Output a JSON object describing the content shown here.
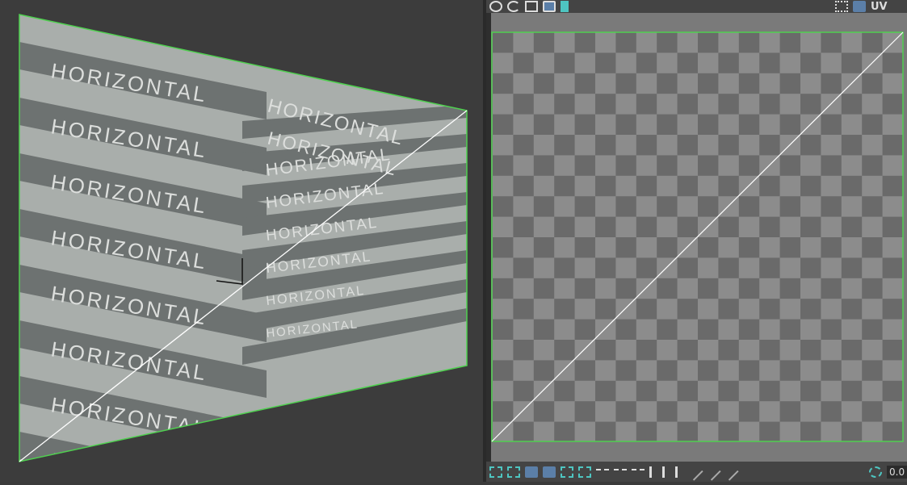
{
  "viewport": {
    "plane_label": "HORIZONTAL",
    "plane_color": "#a9aeab",
    "stripe_color": "#6d7271",
    "edge_color": "#4fd04f"
  },
  "uv_editor": {
    "top_toolbar": {
      "icons": [
        "move-icon",
        "rotate-icon",
        "scale-icon",
        "frame-icon",
        "mirror-icon",
        "checker-small-icon",
        "checker-toggle-icon"
      ],
      "uv_label": "UV"
    },
    "bottom_toolbar": {
      "icons": [
        "snap-points-icon",
        "triangle-select-icon",
        "face-icon",
        "cube-icon",
        "grow-selection-icon",
        "shrink-selection-icon",
        "edge-loop-icon",
        "edge-add-icon",
        "edge-remove-icon",
        "vertical-icon",
        "vertical-add-icon",
        "vertical-remove-icon",
        "brush-icon",
        "brush-add-icon",
        "brush-remove-icon",
        "pivot-icon"
      ],
      "value": "0.0"
    },
    "checker_colors": [
      "#6a6a6a",
      "#8c8c8c"
    ],
    "boundary_color": "#4fd04f"
  }
}
